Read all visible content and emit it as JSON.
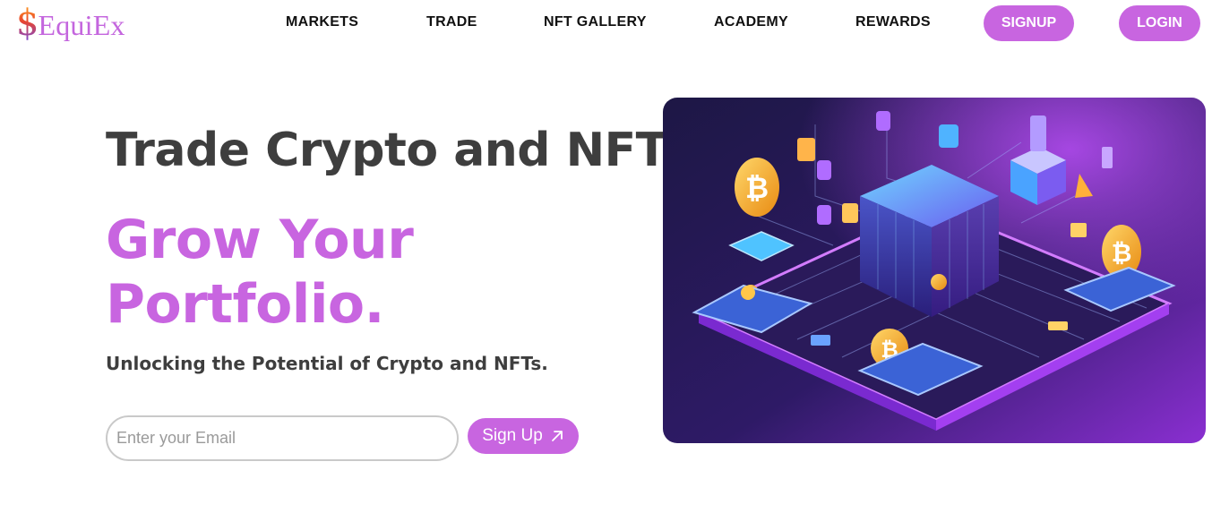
{
  "brand": {
    "logo_symbol": "$",
    "logo_text": "EquiEx"
  },
  "nav": {
    "items": [
      {
        "label": "MARKETS"
      },
      {
        "label": "TRADE"
      },
      {
        "label": "NFT GALLERY"
      },
      {
        "label": "ACADEMY"
      },
      {
        "label": "REWARDS"
      }
    ],
    "signup_label": "SIGNUP",
    "login_label": "LOGIN"
  },
  "hero": {
    "title": "Trade Crypto and NFT",
    "headline_line1": "Grow Your",
    "headline_line2": "Portfolio.",
    "subtitle": "Unlocking the Potential of Crypto and NFTs.",
    "email_placeholder": "Enter your Email",
    "email_value": "",
    "cta_label": "Sign Up",
    "cta_icon": "arrow-up-right-icon",
    "image_icon": "crypto-isometric-illustration"
  },
  "colors": {
    "accent": "#c865e0",
    "text_dark": "#3e3e3e",
    "nav_text": "#111111"
  }
}
